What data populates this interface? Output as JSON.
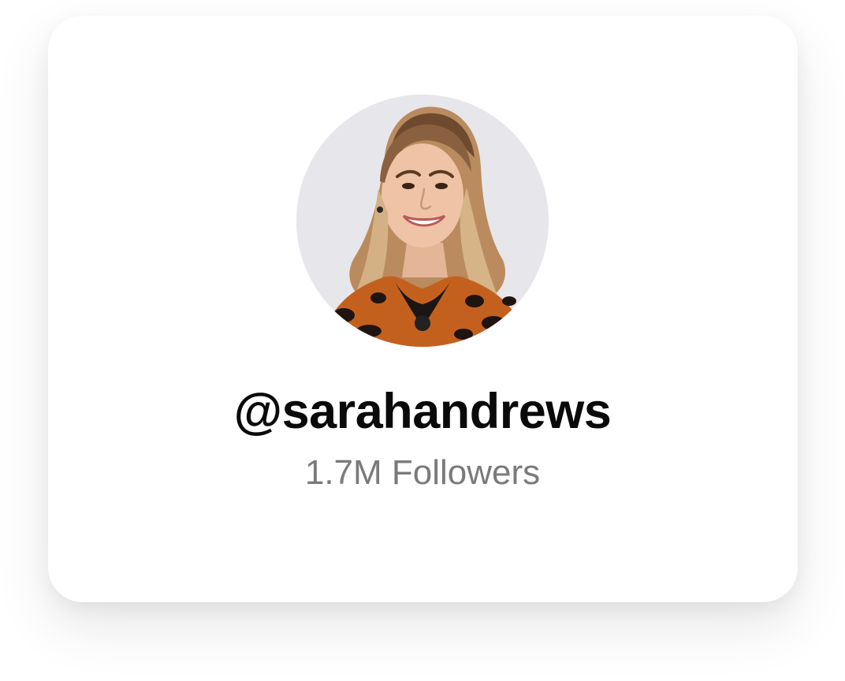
{
  "profile": {
    "username": "@sarahandrews",
    "followers": "1.7M Followers",
    "avatar_icon": "profile-photo"
  },
  "colors": {
    "card_background": "#ffffff",
    "username_text": "#0a0a0a",
    "followers_text": "#7a7a7a",
    "avatar_background": "#e6e6ea"
  }
}
